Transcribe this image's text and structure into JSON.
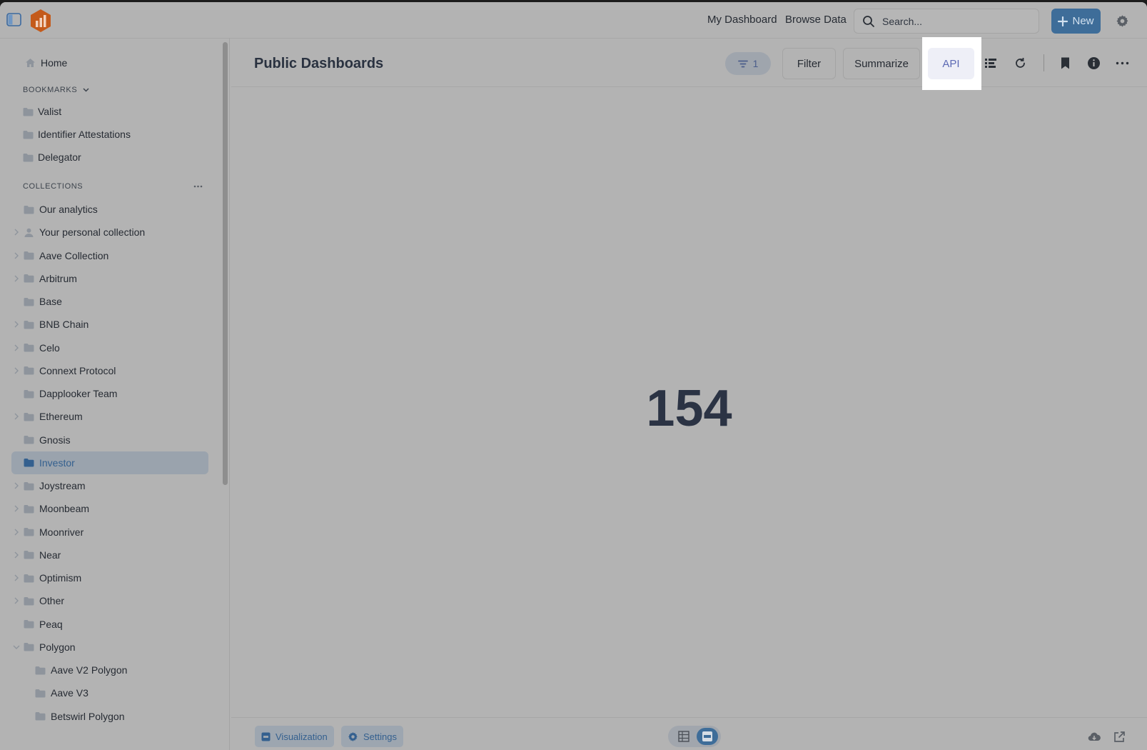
{
  "topbar": {
    "nav": [
      "My Dashboard",
      "Browse Data"
    ],
    "search_placeholder": "Search...",
    "new_label": "New"
  },
  "sidebar": {
    "home_label": "Home",
    "bookmarks_heading": "BOOKMARKS",
    "bookmarks": [
      "Valist",
      "Identifier Attestations",
      "Delegator"
    ],
    "collections_heading": "COLLECTIONS",
    "collections": [
      {
        "label": "Our analytics",
        "chevron": "none",
        "icon": "folder"
      },
      {
        "label": "Your personal collection",
        "chevron": "right",
        "icon": "person"
      },
      {
        "label": "Aave Collection",
        "chevron": "right",
        "icon": "folder"
      },
      {
        "label": "Arbitrum",
        "chevron": "right",
        "icon": "folder"
      },
      {
        "label": "Base",
        "chevron": "none",
        "icon": "folder"
      },
      {
        "label": "BNB Chain",
        "chevron": "right",
        "icon": "folder"
      },
      {
        "label": "Celo",
        "chevron": "right",
        "icon": "folder"
      },
      {
        "label": "Connext Protocol",
        "chevron": "right",
        "icon": "folder"
      },
      {
        "label": "Dapplooker Team",
        "chevron": "none",
        "icon": "folder"
      },
      {
        "label": "Ethereum",
        "chevron": "right",
        "icon": "folder"
      },
      {
        "label": "Gnosis",
        "chevron": "none",
        "icon": "folder"
      },
      {
        "label": "Investor",
        "chevron": "none",
        "icon": "folder",
        "active": true
      },
      {
        "label": "Joystream",
        "chevron": "right",
        "icon": "folder"
      },
      {
        "label": "Moonbeam",
        "chevron": "right",
        "icon": "folder"
      },
      {
        "label": "Moonriver",
        "chevron": "right",
        "icon": "folder"
      },
      {
        "label": "Near",
        "chevron": "right",
        "icon": "folder"
      },
      {
        "label": "Optimism",
        "chevron": "right",
        "icon": "folder"
      },
      {
        "label": "Other",
        "chevron": "right",
        "icon": "folder"
      },
      {
        "label": "Peaq",
        "chevron": "none",
        "icon": "folder"
      },
      {
        "label": "Polygon",
        "chevron": "down",
        "icon": "folder"
      },
      {
        "label": "Aave V2 Polygon",
        "chevron": "none",
        "icon": "folder",
        "child": true
      },
      {
        "label": "Aave V3",
        "chevron": "none",
        "icon": "folder",
        "child": true
      },
      {
        "label": "Betswirl Polygon",
        "chevron": "none",
        "icon": "folder",
        "child": true
      }
    ]
  },
  "header": {
    "title": "Public Dashboards",
    "filter_count": "1",
    "filter_label": "Filter",
    "summarize_label": "Summarize",
    "api_label": "API"
  },
  "main": {
    "value": "154"
  },
  "footer": {
    "visualization_label": "Visualization",
    "settings_label": "Settings"
  },
  "colors": {
    "accent": "#3e6d99",
    "active_item_bg": "#9aa3ad",
    "api_text": "#5d6ab4",
    "logo": "#c45a1a"
  }
}
